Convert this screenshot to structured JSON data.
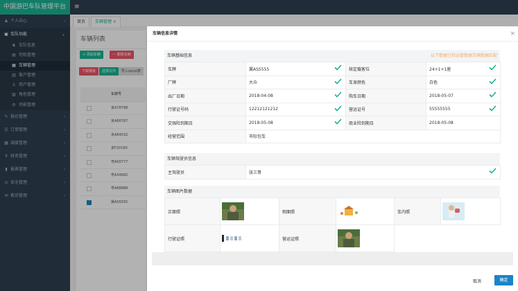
{
  "app": {
    "title": "中国游巴车队管理平台",
    "menu_icon": "menu-icon"
  },
  "sidebar": {
    "items": [
      {
        "label": "个人中心",
        "icon": "user-icon"
      },
      {
        "label": "车队功能",
        "icon": "car-icon"
      },
      {
        "label": "报价管理",
        "icon": "edit-icon"
      },
      {
        "label": "订单管理",
        "icon": "list-icon"
      },
      {
        "label": "调度管理",
        "icon": "calendar-icon"
      },
      {
        "label": "财务管理",
        "icon": "money-icon"
      },
      {
        "label": "报表管理",
        "icon": "chart-icon"
      },
      {
        "label": "安全管理",
        "icon": "shield-icon"
      },
      {
        "label": "客诉管理",
        "icon": "comment-icon"
      }
    ],
    "sub_items": [
      {
        "label": "车队信息",
        "icon": "team-icon"
      },
      {
        "label": "司机管理",
        "icon": "driver-icon"
      },
      {
        "label": "车辆管理",
        "icon": "bus-icon"
      },
      {
        "label": "客户管理",
        "icon": "customer-icon"
      },
      {
        "label": "用户管理",
        "icon": "users-icon"
      },
      {
        "label": "角色管理",
        "icon": "role-icon"
      },
      {
        "label": "功能管理",
        "icon": "gear-icon"
      }
    ]
  },
  "tabs": [
    {
      "label": "首页"
    },
    {
      "label": "车辆管理 ×"
    }
  ],
  "list_page": {
    "title": "车辆列表",
    "add_button": "+ 添加车辆",
    "delete_button": "— 删除车辆",
    "download_button": "下载模板",
    "select_button": "选择文件",
    "import_button": "导入excel表",
    "column_plate": "车牌号",
    "rows": [
      "京A78788",
      "京A86787",
      "京A84032",
      "京F20180",
      "粤A00777",
      "粤A34682",
      "粤A88888",
      "冀AS5555"
    ],
    "checked_index": 7
  },
  "modal": {
    "title": "车辆信息详情",
    "basic": {
      "heading": "车辆基础信息",
      "note": "以下数据已和运管数据车辆数据匹配",
      "rows": [
        {
          "l1": "车牌",
          "v1": "冀AS5555",
          "c1": true,
          "l2": "核定载客位",
          "v2": "24+1+1座",
          "c2": true
        },
        {
          "l1": "厂牌",
          "v1": "大众",
          "c1": true,
          "l2": "车身颜色",
          "v2": "白色",
          "c2": true
        },
        {
          "l1": "出厂日期",
          "v1": "2018-04-08",
          "c1": true,
          "l2": "购车日期",
          "v2": "2018-05-07",
          "c2": true
        },
        {
          "l1": "行驶证号码",
          "v1": "12212121212",
          "c1": true,
          "l2": "营运证号",
          "v2": "55555555",
          "c2": true
        },
        {
          "l1": "交强险到期日",
          "v1": "2018-05-08",
          "c1": true,
          "l2": "商业险到期日",
          "v2": "2018-05-08",
          "c2": false
        }
      ],
      "scope_label": "经营范围",
      "scope_value": "市际包车"
    },
    "driver": {
      "heading": "车辆驾驶员信息",
      "label": "主驾驶员",
      "value": "张三哥"
    },
    "images": {
      "heading": "车辆图片数据",
      "front": "正面照",
      "side": "侧面照",
      "interior": "车内照",
      "license": "行驶证照",
      "operation": "营运证照"
    },
    "cancel": "取消",
    "confirm": "确定"
  },
  "colors": {
    "sidebar": "#2f4050",
    "brand": "#1ab394",
    "primary": "#1c84c6",
    "check": "#1ab394",
    "note": "#f8ac59"
  }
}
